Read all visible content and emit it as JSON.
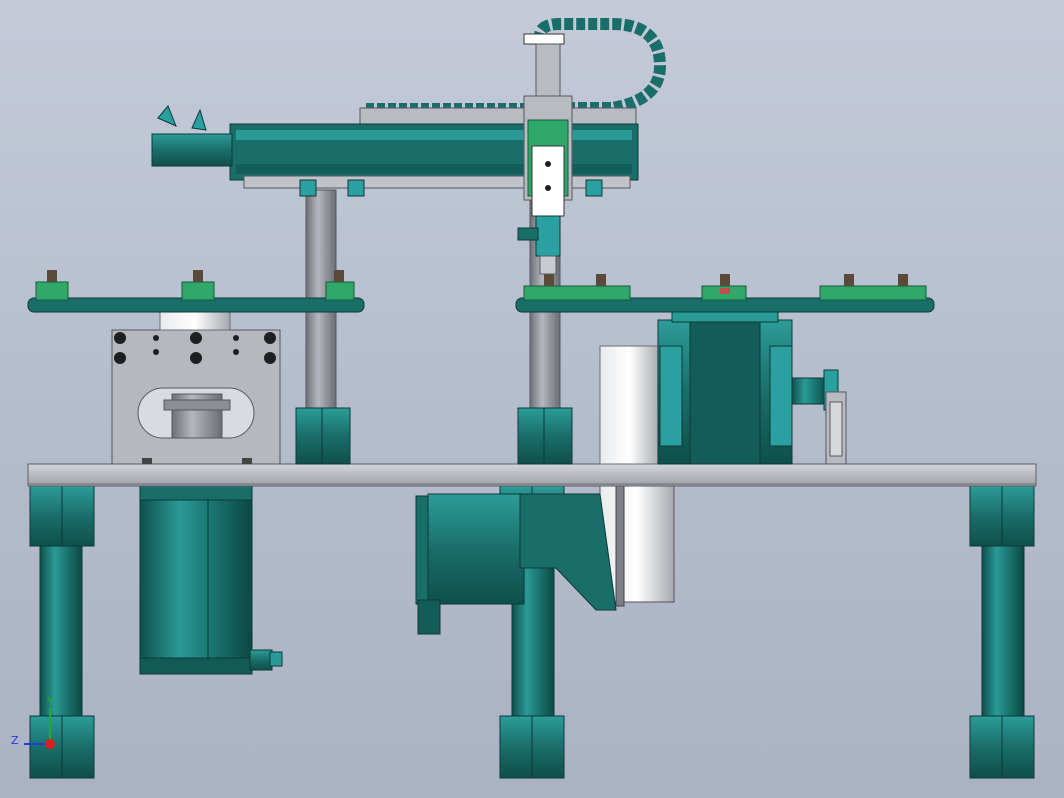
{
  "colors": {
    "background_top": "#c4cad8",
    "background_bottom": "#aab2c4",
    "teal": "#1a6e6a",
    "teal_light": "#2aa0a0",
    "green_block": "#2fa869",
    "steel_plate": "#b8bcc2",
    "column_grey": "#9a9ea4"
  },
  "triad": {
    "y_label": "Y",
    "z_label": "Z",
    "y_color": "#1fae1f",
    "z_color": "#1f3fd8",
    "x_color": "#d81f1f"
  }
}
